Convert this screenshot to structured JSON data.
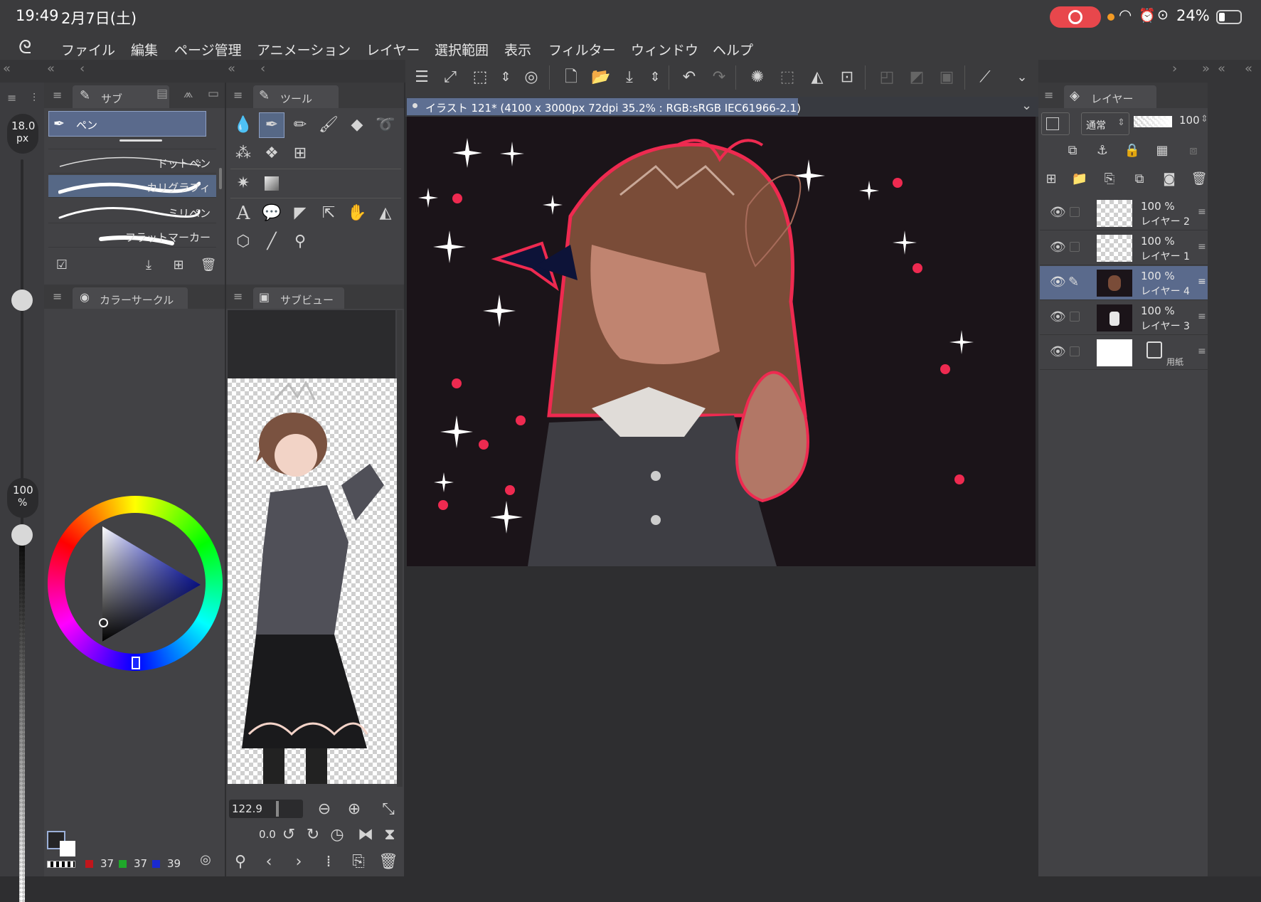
{
  "status": {
    "time": "19:49",
    "date": "2月7日(土)",
    "battery": "24%"
  },
  "menu": [
    "ファイル",
    "編集",
    "ページ管理",
    "アニメーション",
    "レイヤー",
    "選択範囲",
    "表示",
    "フィルター",
    "ウィンドウ",
    "ヘルプ"
  ],
  "brush_panel": {
    "tab_label": "サブ",
    "size_value": "18.0",
    "size_unit": "px",
    "opacity_value": "100",
    "opacity_unit": "%",
    "selected_tool": "ペン",
    "brushes": [
      "ドットペン",
      "カリグラフィ",
      "ミリペン",
      "フラットマーカー"
    ],
    "selected_brush_index": 1
  },
  "tool_panel": {
    "tab_label": "ツール"
  },
  "color_panel": {
    "tab_label": "カラーサークル",
    "r": "37",
    "g": "37",
    "b": "39"
  },
  "subview": {
    "tab_label": "サブビュー",
    "zoom": "122.9",
    "rotation": "0.0"
  },
  "canvas": {
    "title": "イラスト 121* (4100 x 3000px 72dpi 35.2% : RGB:sRGB IEC61966-2.1)"
  },
  "layers": {
    "tab_label": "レイヤー",
    "blend_mode": "通常",
    "opacity": "100",
    "items": [
      {
        "opacity": "100 %",
        "name": "レイヤー 2"
      },
      {
        "opacity": "100 %",
        "name": "レイヤー 1"
      },
      {
        "opacity": "100 %",
        "name": "レイヤー 4"
      },
      {
        "opacity": "100 %",
        "name": "レイヤー 3"
      },
      {
        "opacity": "",
        "name": "用紙"
      }
    ],
    "selected_index": 2
  },
  "colors": {
    "accent": "#7c8aa8",
    "record": "#e8474c",
    "canvas_bg": "#1b1419",
    "panel": "#424245"
  }
}
